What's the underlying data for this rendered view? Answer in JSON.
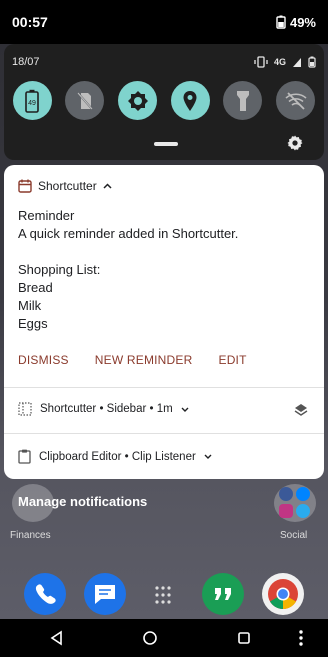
{
  "status_bar": {
    "time": "00:57",
    "battery": "49%"
  },
  "quick_settings": {
    "date": "18/07",
    "network": "4G",
    "tiles": [
      {
        "icon": "battery-saver-icon",
        "state": "on",
        "label": "49"
      },
      {
        "icon": "sim-off-icon",
        "state": "off"
      },
      {
        "icon": "brightness-icon",
        "state": "on"
      },
      {
        "icon": "location-icon",
        "state": "on"
      },
      {
        "icon": "flashlight-icon",
        "state": "off"
      },
      {
        "icon": "wifi-off-icon",
        "state": "off"
      }
    ]
  },
  "notification": {
    "app_name": "Shortcutter",
    "title": "Reminder",
    "text": "A quick reminder added in Shortcutter.",
    "list_title": "Shopping List:",
    "items": [
      "Bread",
      "Milk",
      "Eggs"
    ],
    "actions": [
      "DISMISS",
      "NEW REMINDER",
      "EDIT"
    ]
  },
  "rows": [
    {
      "text": "Shortcutter • Sidebar • 1m",
      "icon": "grid-icon",
      "right_icon": "layers-icon"
    },
    {
      "text": "Clipboard Editor • Clip Listener",
      "icon": "clipboard-icon"
    }
  ],
  "home": {
    "manage_label": "Manage notifications",
    "folder_left": "Finances",
    "folder_right": "Social"
  },
  "colors": {
    "accent_tile": "#7fd3cd",
    "action_text": "#8a3a2c"
  }
}
